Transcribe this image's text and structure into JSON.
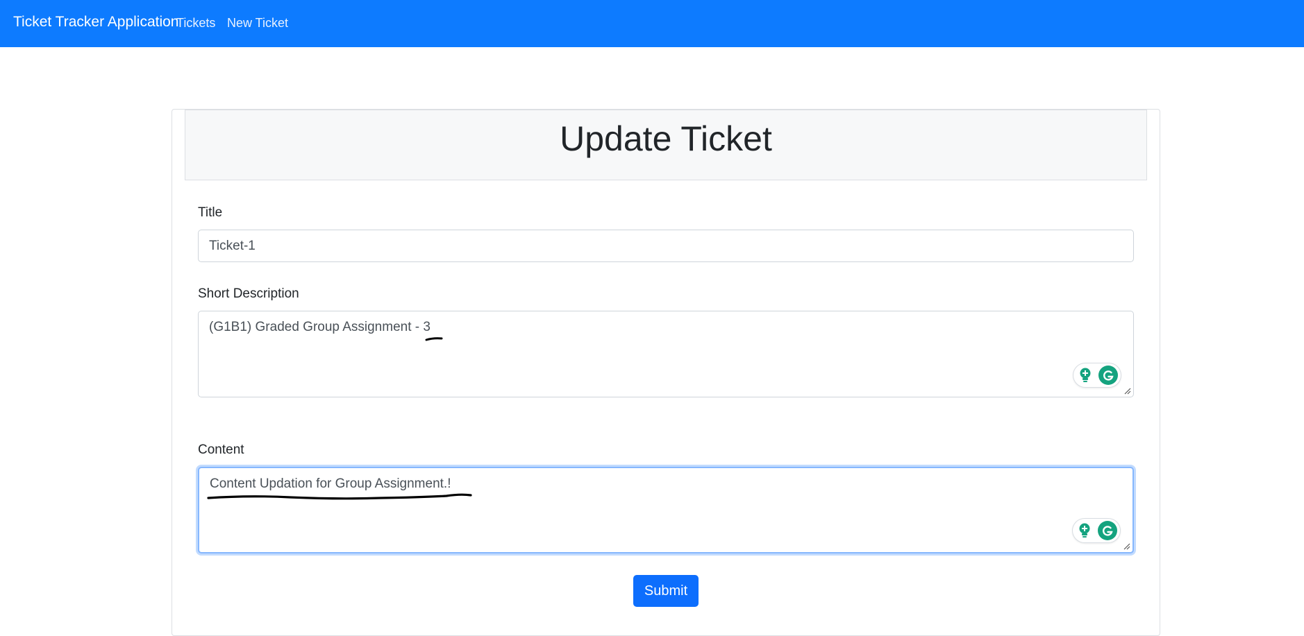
{
  "navbar": {
    "brand": "Ticket Tracker Application",
    "links": [
      {
        "label": "Tickets"
      },
      {
        "label": "New Ticket"
      }
    ]
  },
  "page": {
    "title": "Update Ticket"
  },
  "form": {
    "title_label": "Title",
    "title_value": "Ticket-1",
    "short_description_label": "Short Description",
    "short_description_value": "(G1B1) Graded Group Assignment - 3",
    "content_label": "Content",
    "content_value": "Content Updation for Group Assignment.!",
    "submit_label": "Submit"
  },
  "colors": {
    "navbar": "#0d7bff",
    "primary_button": "#0d6efd",
    "grammarly_green": "#15a37f",
    "focus_border": "#86b7fe"
  },
  "icons": {
    "grammarly_suggestion": "lightbulb-icon",
    "grammarly_logo": "grammarly-g-icon",
    "resize": "resize-handle-icon"
  }
}
